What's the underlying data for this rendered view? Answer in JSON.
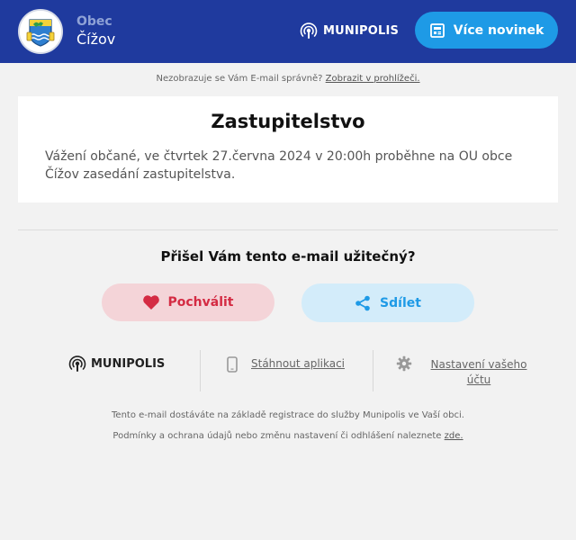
{
  "header": {
    "town_kind": "Obec",
    "town_name": "Čížov",
    "brand": "MUNIPOLIS",
    "more_news_label": "Více novinek",
    "icons": [
      "crest-image",
      "munipolis-logo-icon",
      "newspaper-icon"
    ]
  },
  "notice": {
    "text": "Nezobrazuje se Vám E-mail správně?",
    "link": "Zobrazit v prohlížeči."
  },
  "article": {
    "title": "Zastupitelstvo",
    "body": "Vážení občané, ve čtvrtek 27.června 2024 v 20:00h proběhne na OU obce Čížov zasedání zastupitelstva."
  },
  "feedback": {
    "question": "Přišel Vám tento e-mail užitečný?",
    "like_label": "Pochválit",
    "share_label": "Sdílet",
    "like_color": "#d42b43",
    "share_color": "#1e9ae6"
  },
  "footer": {
    "brand": "MUNIPOLIS",
    "download_label": "Stáhnout aplikaci",
    "settings_label": "Nastavení vašeho účtu",
    "line1": "Tento e-mail dostáváte na základě registrace do služby Munipolis ve Vaší obci.",
    "line2": "Podmínky a ochrana údajů nebo změnu nastavení či odhlášení naleznete",
    "line2_link": "zde."
  },
  "colors": {
    "header_bg": "#1f3a9e",
    "page_bg": "#f2f2f2",
    "accent": "#1e9ae6"
  }
}
